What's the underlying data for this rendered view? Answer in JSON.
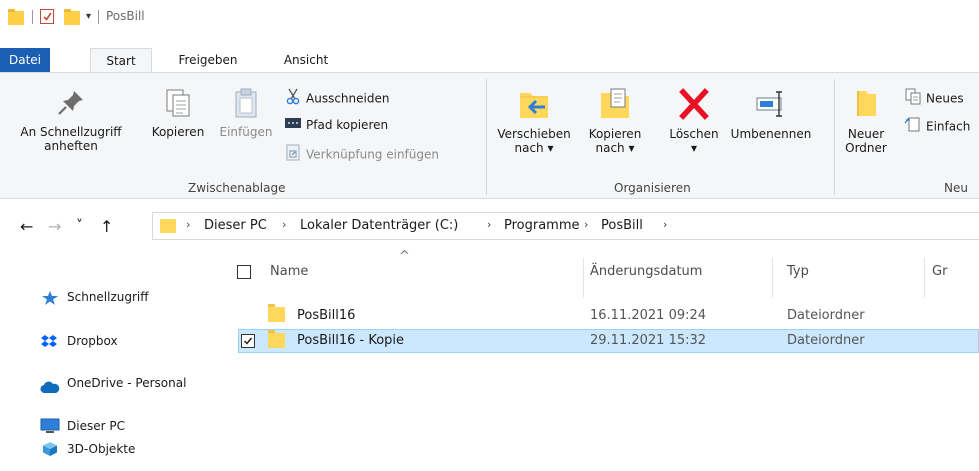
{
  "window": {
    "title": "PosBill"
  },
  "tabs": [
    {
      "label": "Datei"
    },
    {
      "label": "Start"
    },
    {
      "label": "Freigeben"
    },
    {
      "label": "Ansicht"
    }
  ],
  "ribbon": {
    "clipboard": {
      "pin_label_1": "An Schnellzugriff",
      "pin_label_2": "anheften",
      "copy_label": "Kopieren",
      "paste_label": "Einfügen",
      "cut_label": "Ausschneiden",
      "copy_path_label": "Pfad kopieren",
      "paste_shortcut_label": "Verknüpfung einfügen",
      "group_label": "Zwischenablage"
    },
    "organize": {
      "move_label_1": "Verschieben",
      "move_label_2": "nach ▾",
      "copy_to_label_1": "Kopieren",
      "copy_to_label_2": "nach ▾",
      "delete_label": "Löschen",
      "delete_arrow": "▾",
      "rename_label": "Umbenennen",
      "group_label": "Organisieren"
    },
    "new": {
      "new_folder_label_1": "Neuer",
      "new_folder_label_2": "Ordner",
      "new_item_label": "Neues",
      "easy_access_label": "Einfach",
      "group_label": "Neu"
    }
  },
  "address": {
    "back": "←",
    "forward": "→",
    "recent": "˅",
    "up": "↑",
    "crumbs": [
      "Dieser PC",
      "Lokaler Datenträger (C:)",
      "Programme",
      "PosBill"
    ],
    "sep": "›"
  },
  "nav_pane": {
    "items": [
      {
        "label": "Schnellzugriff",
        "icon": "star-icon"
      },
      {
        "label": "Dropbox",
        "icon": "dropbox-icon"
      },
      {
        "label": "OneDrive - Personal",
        "icon": "cloud-icon"
      },
      {
        "label": "Dieser PC",
        "icon": "computer-icon"
      },
      {
        "label": "3D-Objekte",
        "icon": "cube-icon"
      }
    ]
  },
  "file_list": {
    "columns": {
      "name": "Name",
      "modified": "Änderungsdatum",
      "type": "Typ",
      "size": "Gr"
    },
    "sort_arrow": "^",
    "rows": [
      {
        "name": "PosBill16",
        "modified": "16.11.2021 09:24",
        "type": "Dateiordner",
        "selected": false
      },
      {
        "name": "PosBill16 - Kopie",
        "modified": "29.11.2021 15:32",
        "type": "Dateiordner",
        "selected": true
      }
    ]
  },
  "colors": {
    "file_tab": "#1a5fb4",
    "selection": "#cce8ff",
    "selection_border": "#99d1ff",
    "folder": "#ffd75b",
    "delete_red": "#e81123",
    "move_arrow": "#2f7fd8"
  }
}
